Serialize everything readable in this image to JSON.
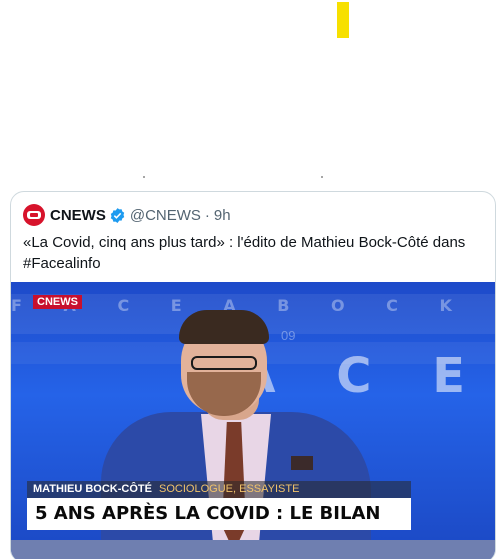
{
  "tweet": {
    "author": {
      "display_name": "CNEWS",
      "handle": "@CNEWS",
      "verified": true,
      "avatar_icon": "cnews-logo-icon"
    },
    "separator": "·",
    "time": "9h",
    "text": "«La Covid, cinq ans plus tard» : l'édito de Mathieu Bock-Côté dans",
    "hashtag": "#Facealinfo"
  },
  "media": {
    "channel_logo": "CNEWS",
    "studio_letters": "F A C E A B O C K",
    "studio_big_letters": "A C E",
    "studio_number": "09",
    "lower_third": {
      "name": "MATHIEU BOCK-CÔTÉ",
      "role": "SOCIOLOGUE, ESSAYISTE",
      "headline": "5 ANS APRÈS LA COVID : LE BILAN"
    }
  },
  "colors": {
    "accent_yellow": "#f7e000",
    "brand_red": "#d7132b",
    "verified_blue": "#1d9bf0",
    "studio_blue": "#2563e8"
  }
}
